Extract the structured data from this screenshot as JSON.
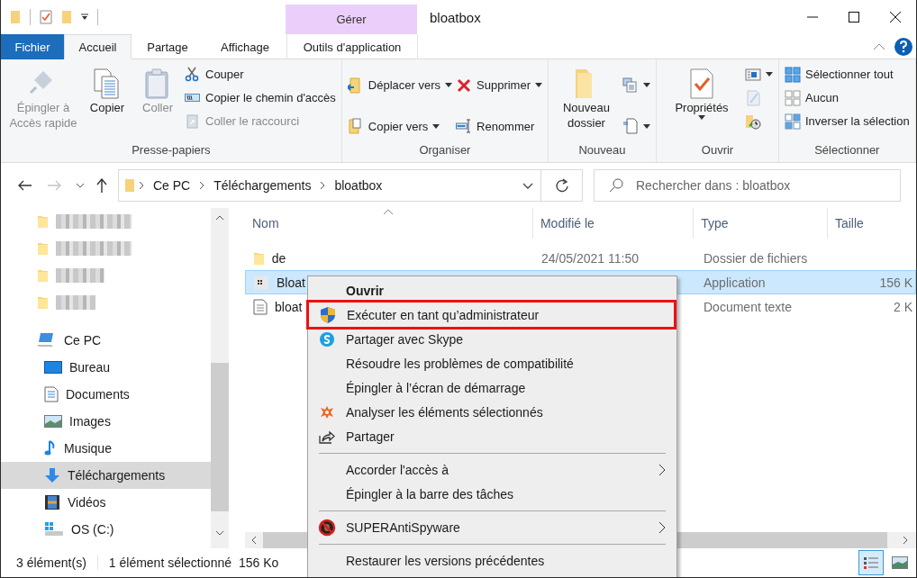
{
  "window": {
    "title": "bloatbox"
  },
  "contextual_group": {
    "label": "Gérer"
  },
  "tabs": [
    {
      "label": "Fichier",
      "kind": "file",
      "selected": false
    },
    {
      "label": "Accueil",
      "kind": "normal",
      "selected": true
    },
    {
      "label": "Partage",
      "kind": "normal",
      "selected": false
    },
    {
      "label": "Affichage",
      "kind": "normal",
      "selected": false
    },
    {
      "label": "Outils d'application",
      "kind": "contextual",
      "selected": false
    }
  ],
  "ribbon": {
    "groups": [
      {
        "label": "Presse-papiers",
        "columns": [
          {
            "items": [
              {
                "label": "Épingler à Accès rapide",
                "kind": "pin",
                "disabled": true
              }
            ]
          },
          {
            "items": [
              {
                "label": "Copier",
                "kind": "copy"
              }
            ]
          },
          {
            "items": [
              {
                "label": "Coller",
                "kind": "paste",
                "disabled": true
              }
            ]
          },
          {
            "items": [
              {
                "label": "Couper",
                "kind": "scissors"
              },
              {
                "label": "Copier le chemin d'accès",
                "kind": "path"
              },
              {
                "label": "Coller le raccourci",
                "kind": "paste_shortcut",
                "disabled": true
              }
            ]
          }
        ]
      },
      {
        "label": "Organiser",
        "columns": [
          {
            "items": [
              {
                "label": "Déplacer vers",
                "kind": "move",
                "dropdown": true
              },
              {
                "label": "Copier vers",
                "kind": "copy_to",
                "dropdown": true
              }
            ]
          },
          {
            "items": [
              {
                "label": "Supprimer",
                "kind": "delete",
                "dropdown": true
              },
              {
                "label": "Renommer",
                "kind": "rename"
              }
            ]
          }
        ]
      },
      {
        "label": "Nouveau",
        "columns": [
          {
            "items": [
              {
                "label": "Nouveau dossier",
                "kind": "new_folder"
              }
            ]
          },
          {
            "items": [
              {
                "kind": "new_item",
                "dropdown": true
              },
              {
                "kind": "easy_access",
                "dropdown": true
              }
            ]
          }
        ]
      },
      {
        "label": "Ouvrir",
        "columns": [
          {
            "items": [
              {
                "label": "Propriétés",
                "kind": "properties",
                "dropdown": true
              }
            ]
          },
          {
            "items": [
              {
                "kind": "open",
                "dropdown": true
              },
              {
                "kind": "edit",
                "disabled": true
              },
              {
                "kind": "history"
              }
            ]
          }
        ]
      },
      {
        "label": "Sélectionner",
        "columns": [
          {
            "items": [
              {
                "label": "Sélectionner tout",
                "kind": "select_all"
              },
              {
                "label": "Aucun",
                "kind": "select_none"
              },
              {
                "label": "Inverser la sélection",
                "kind": "invert"
              }
            ]
          }
        ]
      }
    ]
  },
  "address_bar": {
    "breadcrumbs": [
      "Ce PC",
      "Téléchargements",
      "bloatbox"
    ]
  },
  "search": {
    "placeholder": "Rechercher dans : bloatbox"
  },
  "navigation": [
    {
      "kind": "folder",
      "redacted": true,
      "selected": false
    },
    {
      "kind": "folder",
      "redacted": true,
      "selected": false
    },
    {
      "kind": "folder",
      "redacted": true,
      "selected": false
    },
    {
      "kind": "folder",
      "redacted": true,
      "selected": false
    },
    {
      "kind": "pc",
      "label": "Ce PC",
      "selected": false,
      "children": [
        {
          "kind": "desktop",
          "label": "Bureau",
          "selected": false
        },
        {
          "kind": "documents",
          "label": "Documents",
          "selected": false
        },
        {
          "kind": "pictures",
          "label": "Images",
          "selected": false
        },
        {
          "kind": "music",
          "label": "Musique",
          "selected": false
        },
        {
          "kind": "downloads",
          "label": "Téléchargements",
          "selected": true
        },
        {
          "kind": "videos",
          "label": "Vidéos",
          "selected": false
        },
        {
          "kind": "drive",
          "label": "OS (C:)",
          "selected": false
        }
      ]
    }
  ],
  "file_list": {
    "columns": [
      "Nom",
      "Modifié le",
      "Type",
      "Taille"
    ],
    "rows": [
      {
        "kind": "folder",
        "name": "de",
        "modified": "24/05/2021 11:50",
        "type": "Dossier de fichiers",
        "selected": false
      },
      {
        "kind": "application",
        "name": "Bloat",
        "type": "Application",
        "size": "156 K",
        "selected": true
      },
      {
        "kind": "text",
        "name": "bloat",
        "type": "Document texte",
        "size": "2 K",
        "selected": false
      }
    ]
  },
  "context_menu": {
    "items": [
      {
        "kind": "plain",
        "label": "Ouvrir",
        "default": true
      },
      {
        "kind": "shield",
        "label": "Exécuter en tant qu’administrateur",
        "highlighted": true
      },
      {
        "kind": "skype",
        "label": "Partager avec Skype"
      },
      {
        "kind": "plain",
        "label": "Résoudre les problèmes de compatibilité"
      },
      {
        "kind": "plain",
        "label": "Épingler à l’écran de démarrage"
      },
      {
        "kind": "antivirus",
        "label": "Analyser les éléments sélectionnés"
      },
      {
        "kind": "share",
        "label": "Partager"
      },
      {
        "kind": "separator"
      },
      {
        "kind": "plain",
        "label": "Accorder l'accès à",
        "submenu": true
      },
      {
        "kind": "plain",
        "label": "Épingler à la barre des tâches"
      },
      {
        "kind": "separator"
      },
      {
        "kind": "no_bug",
        "label": "SUPERAntiSpyware",
        "submenu": true
      },
      {
        "kind": "separator"
      },
      {
        "kind": "plain",
        "label": "Restaurer les versions précédentes"
      }
    ]
  },
  "status_bar": {
    "item_count": "3 élément(s)",
    "selection": "1 élément sélectionné",
    "selection_size": "156 Ko",
    "views": [
      {
        "kind": "details",
        "selected": true
      },
      {
        "kind": "large_icons",
        "selected": false
      }
    ]
  }
}
